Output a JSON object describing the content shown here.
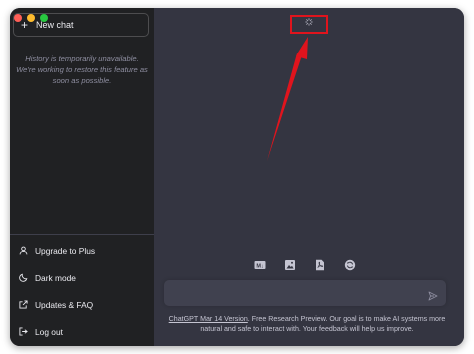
{
  "sidebar": {
    "new_chat_label": "New chat",
    "history_note": "History is temporarily unavailable. We're working to restore this feature as soon as possible.",
    "items": [
      {
        "label": "Upgrade to Plus",
        "icon": "user-icon"
      },
      {
        "label": "Dark mode",
        "icon": "moon-icon"
      },
      {
        "label": "Updates & FAQ",
        "icon": "external-link-icon"
      },
      {
        "label": "Log out",
        "icon": "logout-icon"
      }
    ]
  },
  "main": {
    "tool_icons": [
      "markdown-icon",
      "image-icon",
      "pdf-icon",
      "refresh-icon"
    ],
    "input_placeholder": "",
    "footer_link": "ChatGPT Mar 14 Version",
    "footer_text": ". Free Research Preview. Our goal is to make AI systems more natural and safe to interact with. Your feedback will help us improve."
  },
  "colors": {
    "sidebar_bg": "#202123",
    "main_bg": "#343541",
    "input_bg": "#40414f",
    "annotation": "#e0141d"
  }
}
